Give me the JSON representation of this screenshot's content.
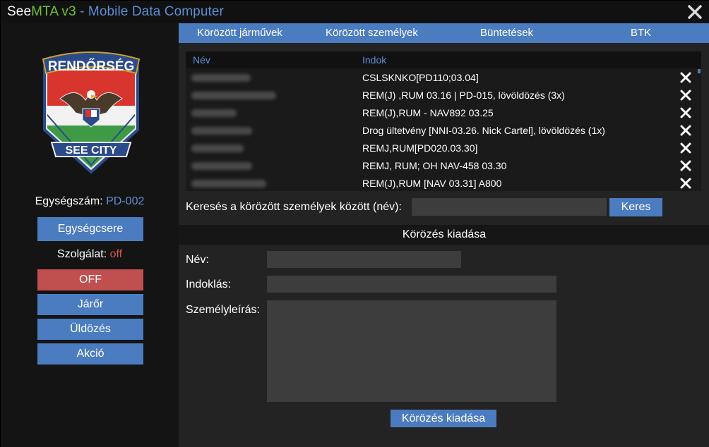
{
  "title": {
    "part1": "See",
    "part2": "MTA v3",
    "part3": " - Mobile Data Computer"
  },
  "sidebar": {
    "badge_top_text": "RENDŐRSÉG",
    "badge_bottom_text": "SEE CITY",
    "unit_label": "Egységszám: ",
    "unit_value": "PD-002",
    "change_unit_button": "Egységcsere",
    "duty_label": "Szolgálat: ",
    "duty_value": "off",
    "buttons": {
      "off": "OFF",
      "patrol": "Járőr",
      "pursuit": "Üldözés",
      "action": "Akció"
    }
  },
  "tabs": [
    {
      "label": "Körözött járművek"
    },
    {
      "label": "Körözött személyek"
    },
    {
      "label": "Büntetések"
    },
    {
      "label": "BTK"
    }
  ],
  "table": {
    "col_name": "Név",
    "col_reason": "Indok",
    "rows": [
      {
        "reason": "CSLSKNKO[PD110;03.04]"
      },
      {
        "reason": "REM(J) ,RUM 03.16 | PD-015, lövöldözés (3x)"
      },
      {
        "reason": "REM(J),RUM - NAV892 03.25"
      },
      {
        "reason": "Drog ültetvény [NNI-03.26. Nick Cartel], lövöldözés (1x)"
      },
      {
        "reason": "REMJ,RUM[PD020.03.30]"
      },
      {
        "reason": "REMJ, RUM; OH NAV-458 03.30"
      },
      {
        "reason": "REM(J),RUM [NAV 03.31] A800"
      }
    ]
  },
  "search": {
    "label": "Keresés a körözött személyek között (név):",
    "value": "",
    "button": "Keres"
  },
  "form": {
    "section_title": "Körözés kiadása",
    "name_label": "Név:",
    "reason_label": "Indoklás:",
    "description_label": "Személyleírás:",
    "submit_button": "Körözés kiadása"
  },
  "colors": {
    "accent_blue": "#4b7cc0",
    "off_red": "#c04f4f",
    "mta_green": "#6fbf3a"
  }
}
